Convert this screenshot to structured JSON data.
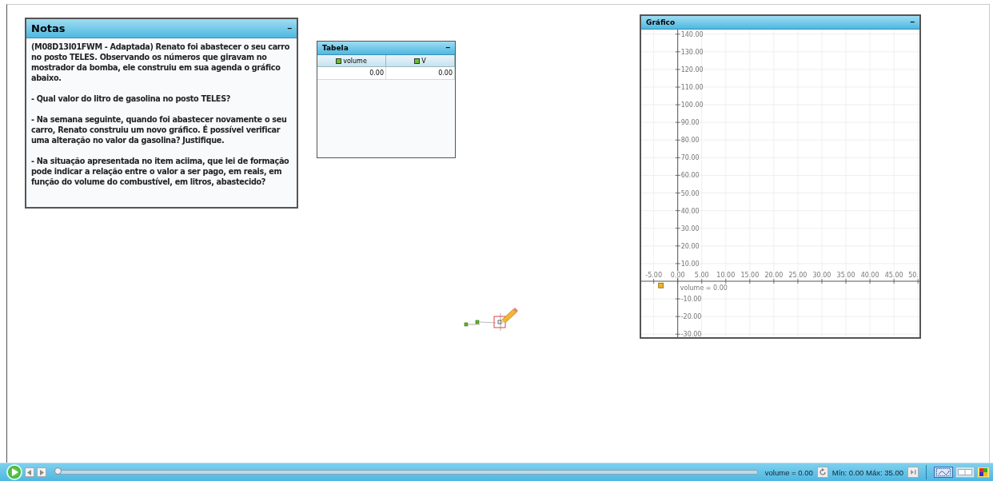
{
  "notes": {
    "title": "Notas",
    "minimize": "–",
    "paragraphs": [
      "(M08D13I01FWM - Adaptada) Renato foi abastecer o seu carro no posto TELES. Observando os números que giravam no mostrador da bomba, ele construiu em sua agenda o gráfico abaixo.",
      "- Qual valor do litro de gasolina no posto TELES?",
      "- Na semana seguinte, quando foi abastecer novamente o seu carro, Renato construiu um novo gráfico. É possível verificar uma alteração no valor da gasolina? Justifique.",
      "- Na situação apresentada no item aciima, que lei de formação pode indicar a relação entre o valor a ser pago, em reais, em função do volume do combustível, em litros, abastecido?"
    ]
  },
  "table": {
    "title": "Tabela",
    "minimize": "–",
    "columns": [
      {
        "label": "volume",
        "color": "#6abf2a"
      },
      {
        "label": "V",
        "color": "#6abf2a"
      }
    ],
    "rows": [
      [
        "0.00",
        "0.00"
      ]
    ]
  },
  "graph": {
    "title": "Gráfico",
    "minimize": "–",
    "chart_data": {
      "type": "scatter",
      "grid": true,
      "xlim": [
        -7.6,
        50.3
      ],
      "ylim": [
        -31.7,
        142.6
      ],
      "xticks": [
        {
          "value": -5,
          "label": "-5.00"
        },
        {
          "value": 0,
          "label": "0.00"
        },
        {
          "value": 5,
          "label": "5.00"
        },
        {
          "value": 10,
          "label": "10.00"
        },
        {
          "value": 15,
          "label": "15.00"
        },
        {
          "value": 20,
          "label": "20.00"
        },
        {
          "value": 25,
          "label": "25.00"
        },
        {
          "value": 30,
          "label": "30.00"
        },
        {
          "value": 35,
          "label": "35.00"
        },
        {
          "value": 40,
          "label": "40.00"
        },
        {
          "value": 45,
          "label": "45.00"
        },
        {
          "value": 50,
          "label": "50."
        }
      ],
      "yticks": [
        {
          "value": 140,
          "label": "140.00"
        },
        {
          "value": 130,
          "label": "130.00"
        },
        {
          "value": 120,
          "label": "120.00"
        },
        {
          "value": 110,
          "label": "110.00"
        },
        {
          "value": 100,
          "label": "100.00"
        },
        {
          "value": 90,
          "label": "90.00"
        },
        {
          "value": 80,
          "label": "80.00"
        },
        {
          "value": 70,
          "label": "70.00"
        },
        {
          "value": 60,
          "label": "60.00"
        },
        {
          "value": 50,
          "label": "50.00"
        },
        {
          "value": 40,
          "label": "40.00"
        },
        {
          "value": 30,
          "label": "30.00"
        },
        {
          "value": 20,
          "label": "20.00"
        },
        {
          "value": 10,
          "label": "10.00"
        },
        {
          "value": -10,
          "label": "-10.00"
        },
        {
          "value": -20,
          "label": "-20.00"
        },
        {
          "value": -30,
          "label": "-30.00"
        }
      ],
      "series": [
        {
          "name": "volume = 0.00",
          "color": "#f0b21e",
          "x": [
            -3.5
          ],
          "values": [
            -2.4
          ]
        }
      ]
    }
  },
  "player": {
    "level": 0,
    "variable": "volume  = 0.00",
    "range": "Mín: 0.00 Máx: 35.00"
  }
}
